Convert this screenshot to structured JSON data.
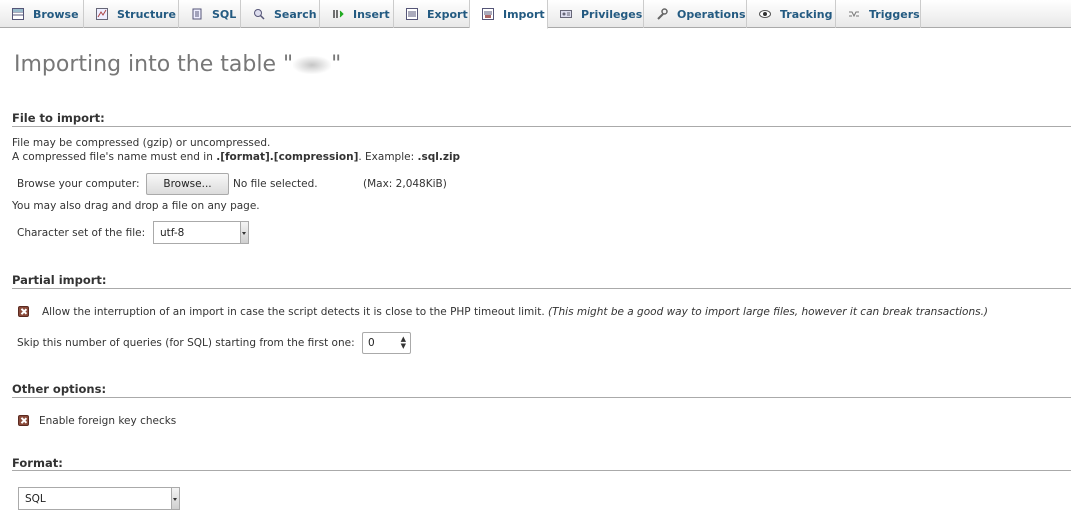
{
  "tabs": [
    {
      "label": "Browse",
      "icon": "browse-icon",
      "active": false
    },
    {
      "label": "Structure",
      "icon": "structure-icon",
      "active": false
    },
    {
      "label": "SQL",
      "icon": "sql-icon",
      "active": false
    },
    {
      "label": "Search",
      "icon": "search-icon",
      "active": false
    },
    {
      "label": "Insert",
      "icon": "insert-icon",
      "active": false
    },
    {
      "label": "Export",
      "icon": "export-icon",
      "active": false
    },
    {
      "label": "Import",
      "icon": "import-icon",
      "active": true
    },
    {
      "label": "Privileges",
      "icon": "privileges-icon",
      "active": false
    },
    {
      "label": "Operations",
      "icon": "wrench-icon",
      "active": false
    },
    {
      "label": "Tracking",
      "icon": "eye-icon",
      "active": false
    },
    {
      "label": "Triggers",
      "icon": "triggers-icon",
      "active": false
    }
  ],
  "page": {
    "title_prefix": "Importing into the table \"",
    "title_suffix": "\""
  },
  "file_import": {
    "heading": "File to import:",
    "line1": "File may be compressed (gzip) or uncompressed.",
    "line2_prefix": "A compressed file's name must end in ",
    "line2_bold": ".[format].[compression]",
    "line2_mid": ". Example: ",
    "line2_example": ".sql.zip",
    "browse_label": "Browse your computer:",
    "browse_button": "Browse...",
    "no_file": "No file selected.",
    "max_size": "(Max: 2,048KiB)",
    "drag_drop": "You may also drag and drop a file on any page.",
    "charset_label": "Character set of the file:",
    "charset_value": "utf-8"
  },
  "partial_import": {
    "heading": "Partial import:",
    "allow_interrupt_label": "Allow the interruption of an import in case the script detects it is close to the PHP timeout limit.",
    "allow_interrupt_note": "(This might be a good way to import large files, however it can break transactions.)",
    "allow_interrupt_checked": true,
    "skip_label": "Skip this number of queries (for SQL) starting from the first one:",
    "skip_value": "0"
  },
  "other_options": {
    "heading": "Other options:",
    "fk_label": "Enable foreign key checks",
    "fk_checked": true
  },
  "format": {
    "heading": "Format:",
    "value": "SQL"
  }
}
